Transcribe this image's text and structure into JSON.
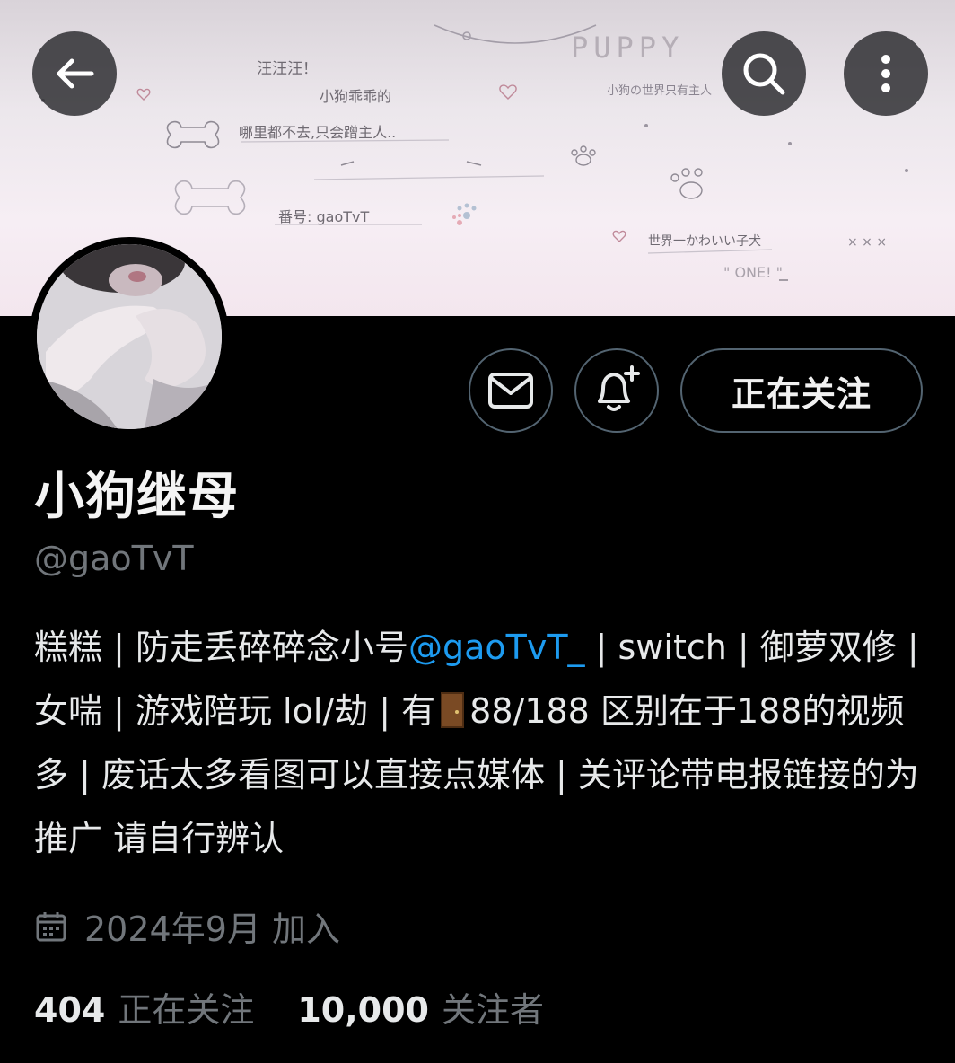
{
  "header": {
    "back_icon": "arrow-left-icon",
    "search_icon": "search-icon",
    "more_icon": "more-vertical-icon"
  },
  "banner": {
    "doodles": [
      "汪汪汪！",
      "小狗乖乖的",
      "哪里都不去,只会蹭主人..",
      "番号: gaoTvT",
      "PUPPY",
      "小狗の世界只有主人",
      "世界一かわいい子犬",
      "\" ONE! \"",
      "× × ×"
    ]
  },
  "actions": {
    "mail_icon": "mail-icon",
    "bell_icon": "bell-plus-icon",
    "follow_label": "正在关注"
  },
  "profile": {
    "display_name": "小狗继母",
    "handle": "@gaoTvT",
    "bio": {
      "part1": "糕糕 | 防走丢碎碎念小号",
      "mention": "@gaoTvT_",
      "part2": " | switch | 御萝双修 | 女喘 | 游戏陪玩 lol/劫 | 有",
      "part3": "88/188 区别在于188的视频多 | 废话太多看图可以直接点媒体 | 关评论带电报链接的为推广 请自行辨认"
    },
    "joined": "2024年9月 加入"
  },
  "stats": {
    "following_count": "404",
    "following_label": "正在关注",
    "followers_count": "10,000",
    "followers_label": "关注者"
  },
  "colors": {
    "background": "#000000",
    "text": "#e7e9ea",
    "muted": "#71767b",
    "link": "#1d9bf0",
    "border": "#536471"
  }
}
